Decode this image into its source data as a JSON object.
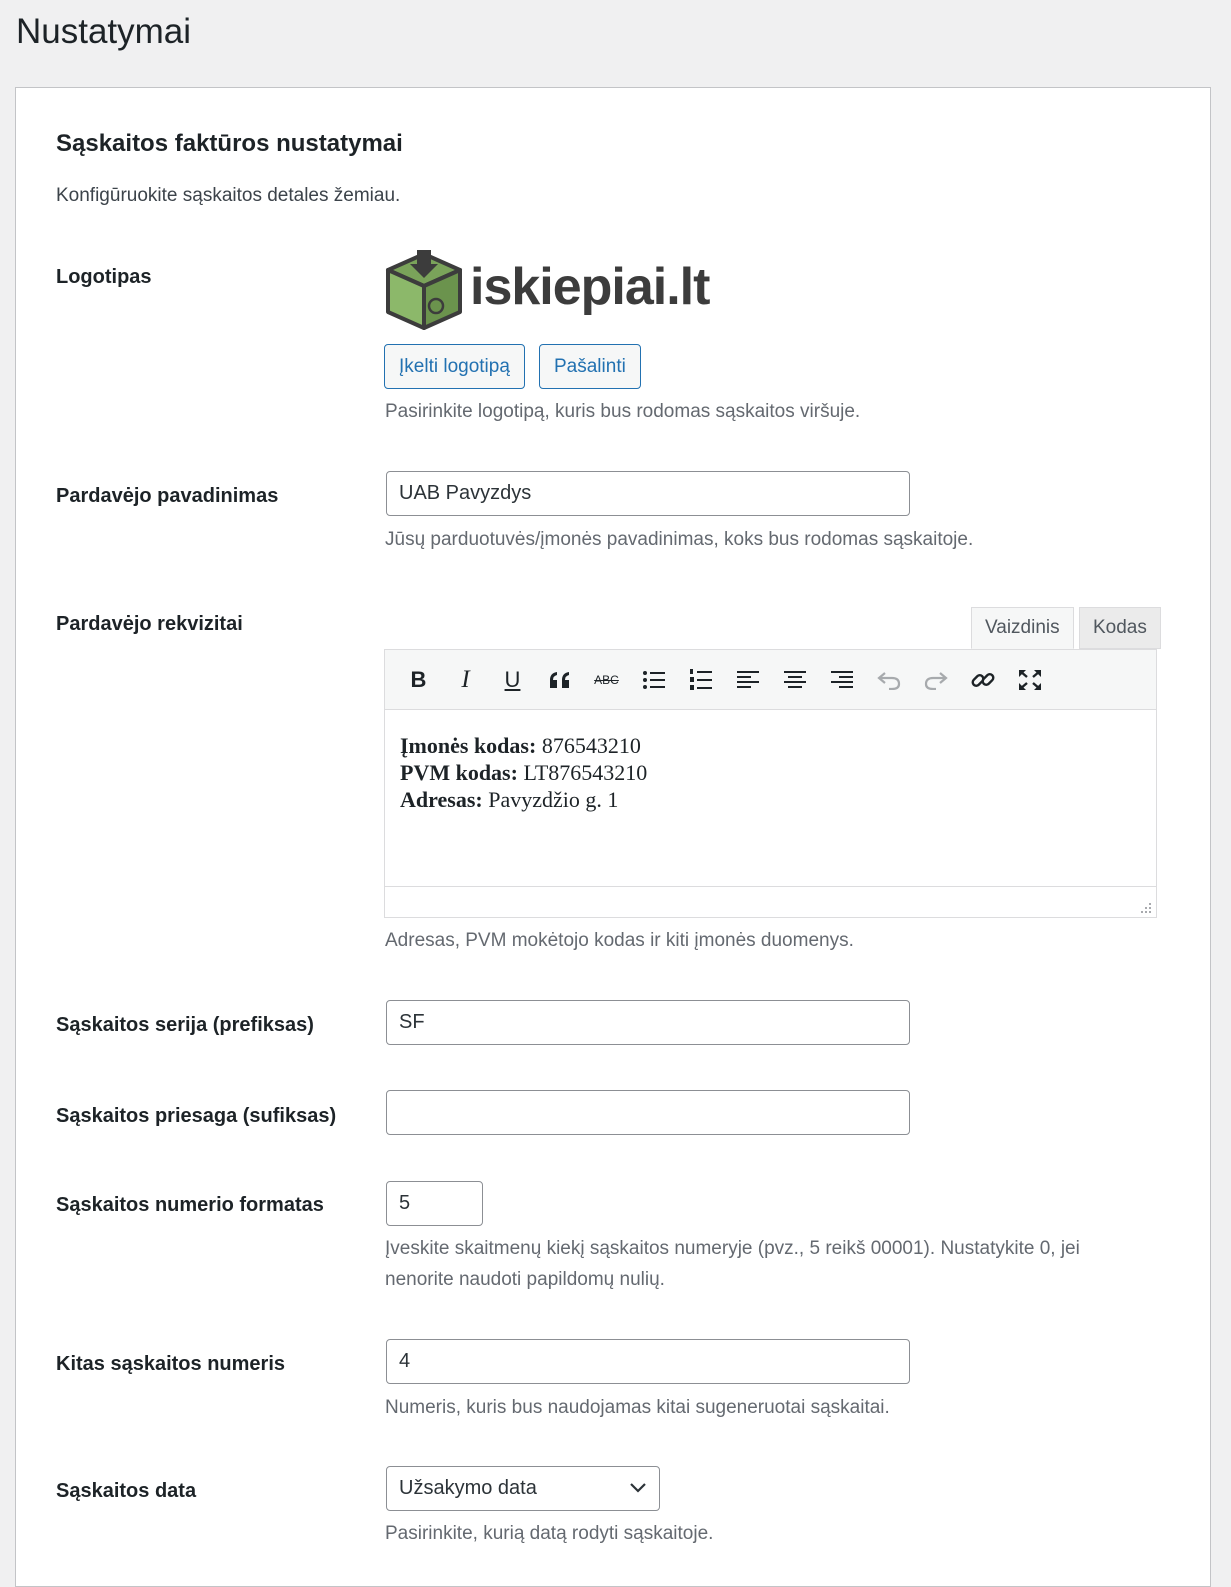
{
  "page": {
    "title": "Nustatymai"
  },
  "section": {
    "title": "Sąskaitos faktūros nustatymai",
    "description": "Konfigūruokite sąskaitos detales žemiau."
  },
  "logo": {
    "label": "Logotipas",
    "image_text": "iskiepiai.lt",
    "upload_label": "Įkelti logotipą",
    "remove_label": "Pašalinti",
    "description": "Pasirinkite logotipą, kuris bus rodomas sąskaitos viršuje."
  },
  "seller_name": {
    "label": "Pardavėjo pavadinimas",
    "value": "UAB Pavyzdys",
    "description": "Jūsų parduotuvės/įmonės pavadinimas, koks bus rodomas sąskaitoje."
  },
  "seller_details": {
    "label": "Pardavėjo rekvizitai",
    "tab_visual": "Vaizdinis",
    "tab_code": "Kodas",
    "lines": [
      {
        "key": "Įmonės kodas:",
        "value": " 876543210"
      },
      {
        "key": "PVM kodas:",
        "value": " LT876543210"
      },
      {
        "key": "Adresas:",
        "value": " Pavyzdžio g. 1"
      }
    ],
    "toolbar": {
      "bold": "B",
      "italic": "I",
      "underline": "U",
      "strike": "ABC"
    },
    "description": "Adresas, PVM mokėtojo kodas ir kiti įmonės duomenys."
  },
  "prefix": {
    "label": "Sąskaitos serija (prefiksas)",
    "value": "SF"
  },
  "suffix": {
    "label": "Sąskaitos priesaga (sufiksas)",
    "value": ""
  },
  "number_format": {
    "label": "Sąskaitos numerio formatas",
    "value": "5",
    "description_line1": "Įveskite skaitmenų kiekį sąskaitos numeryje (pvz., 5 reikš 00001). Nustatykite 0, jei",
    "description_line2": "nenorite naudoti papildomų nulių."
  },
  "next_number": {
    "label": "Kitas sąskaitos numeris",
    "value": "4",
    "description": "Numeris, kuris bus naudojamas kitai sugeneruotai sąskaitai."
  },
  "invoice_date": {
    "label": "Sąskaitos data",
    "selected": "Užsakymo data",
    "description": "Pasirinkite, kurią datą rodyti sąskaitoje."
  },
  "icons": [
    "box-logo-icon",
    "bold-icon",
    "italic-icon",
    "underline-icon",
    "blockquote-icon",
    "strikethrough-icon",
    "bullet-list-icon",
    "numbered-list-icon",
    "align-left-icon",
    "align-center-icon",
    "align-right-icon",
    "undo-icon",
    "redo-icon",
    "link-icon",
    "fullscreen-icon",
    "resize-handle-icon",
    "chevron-down-icon"
  ],
  "colors": {
    "accent": "#2271b1",
    "logo_green": "#7aa35a",
    "logo_dark": "#3c3c3c"
  }
}
